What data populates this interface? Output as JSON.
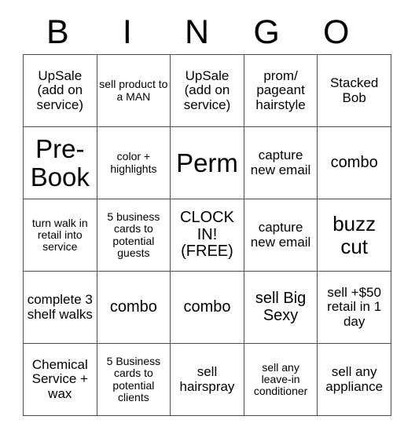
{
  "card": {
    "title": "Bingo Card",
    "header_letters": [
      "B",
      "I",
      "N",
      "G",
      "O"
    ],
    "columns": 5,
    "rows": 5,
    "border_color": "#4d4d4d",
    "background_color": "#ffffff",
    "text_color": "#000000",
    "free_space": "CLOCK IN! (FREE)",
    "cells": [
      [
        {
          "text": "UpSale (add on service)",
          "size": "fs-md"
        },
        {
          "text": "sell product to a MAN",
          "size": "fs-sm"
        },
        {
          "text": "UpSale (add on service)",
          "size": "fs-md"
        },
        {
          "text": "prom/ pageant hairstyle",
          "size": "fs-md"
        },
        {
          "text": "Stacked Bob",
          "size": "fs-md"
        }
      ],
      [
        {
          "text": "Pre-Book",
          "size": "fs-xxl"
        },
        {
          "text": "color + highlights",
          "size": "fs-sm"
        },
        {
          "text": "Perm",
          "size": "fs-xxl"
        },
        {
          "text": "capture new email",
          "size": "fs-md"
        },
        {
          "text": "combo",
          "size": "fs-lg"
        }
      ],
      [
        {
          "text": "turn walk in retail into service",
          "size": "fs-sm"
        },
        {
          "text": "5 business cards to potential guests",
          "size": "fs-sm"
        },
        {
          "text": "CLOCK IN! (FREE)",
          "size": "fs-lg"
        },
        {
          "text": "capture new email",
          "size": "fs-md"
        },
        {
          "text": "buzz cut",
          "size": "fs-xl"
        }
      ],
      [
        {
          "text": "complete 3 shelf walks",
          "size": "fs-md"
        },
        {
          "text": "combo",
          "size": "fs-lg"
        },
        {
          "text": "combo",
          "size": "fs-lg"
        },
        {
          "text": "sell Big Sexy",
          "size": "fs-lg"
        },
        {
          "text": "sell +$50 retail in 1 day",
          "size": "fs-md"
        }
      ],
      [
        {
          "text": "Chemical Service + wax",
          "size": "fs-md"
        },
        {
          "text": "5 Business cards to potential clients",
          "size": "fs-sm"
        },
        {
          "text": "sell hairspray",
          "size": "fs-md"
        },
        {
          "text": "sell any leave-in conditioner",
          "size": "fs-sm"
        },
        {
          "text": "sell any appliance",
          "size": "fs-md"
        }
      ]
    ]
  }
}
